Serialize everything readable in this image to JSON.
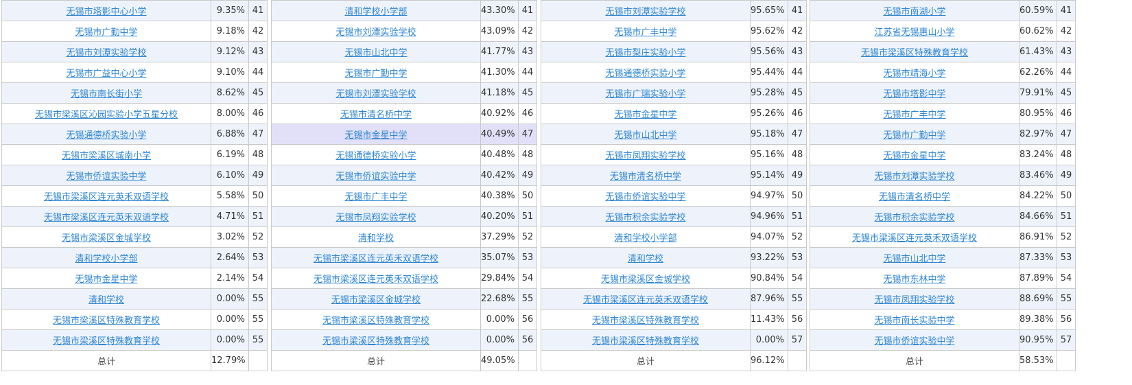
{
  "tables": [
    {
      "rows": [
        {
          "name": "无锡市塔影中心小学",
          "pct": "9.35%",
          "rank": "41"
        },
        {
          "name": "无锡市广勤中学",
          "pct": "9.18%",
          "rank": "42"
        },
        {
          "name": "无锡市刘潭实验学校",
          "pct": "9.12%",
          "rank": "43"
        },
        {
          "name": "无锡市广益中心小学",
          "pct": "9.10%",
          "rank": "44"
        },
        {
          "name": "无锡市南长街小学",
          "pct": "8.62%",
          "rank": "45"
        },
        {
          "name": "无锡市梁溪区沁园实验小学五星分校",
          "pct": "8.00%",
          "rank": "46"
        },
        {
          "name": "无锡通德桥实验小学",
          "pct": "6.88%",
          "rank": "47"
        },
        {
          "name": "无锡市梁溪区城南小学",
          "pct": "6.19%",
          "rank": "48"
        },
        {
          "name": "无锡市侨谊实验中学",
          "pct": "6.10%",
          "rank": "49"
        },
        {
          "name": "无锡市梁溪区连元英禾双语学校",
          "pct": "5.58%",
          "rank": "50"
        },
        {
          "name": "无锡市梁溪区连元英禾双语学校",
          "pct": "4.71%",
          "rank": "51"
        },
        {
          "name": "无锡市梁溪区金城学校",
          "pct": "3.02%",
          "rank": "52"
        },
        {
          "name": "清和学校小学部",
          "pct": "2.64%",
          "rank": "53"
        },
        {
          "name": "无锡市金星中学",
          "pct": "2.14%",
          "rank": "54"
        },
        {
          "name": "清和学校",
          "pct": "0.00%",
          "rank": "55"
        },
        {
          "name": "无锡市梁溪区特殊教育学校",
          "pct": "0.00%",
          "rank": "55"
        },
        {
          "name": "无锡市梁溪区特殊教育学校",
          "pct": "0.00%",
          "rank": "55"
        }
      ],
      "total": {
        "label": "总计",
        "pct": "12.79%"
      }
    },
    {
      "rows": [
        {
          "name": "清和学校小学部",
          "pct": "43.30%",
          "rank": "41"
        },
        {
          "name": "无锡市刘潭实验学校",
          "pct": "43.09%",
          "rank": "42"
        },
        {
          "name": "无锡市山北中学",
          "pct": "41.77%",
          "rank": "43"
        },
        {
          "name": "无锡市广勤中学",
          "pct": "41.30%",
          "rank": "44"
        },
        {
          "name": "无锡市刘潭实验学校",
          "pct": "41.18%",
          "rank": "45"
        },
        {
          "name": "无锡市清名桥中学",
          "pct": "40.92%",
          "rank": "46"
        },
        {
          "name": "无锡市金星中学",
          "pct": "40.49%",
          "rank": "47",
          "highlight": true
        },
        {
          "name": "无锡通德桥实验小学",
          "pct": "40.48%",
          "rank": "48"
        },
        {
          "name": "无锡市侨谊实验中学",
          "pct": "40.42%",
          "rank": "49"
        },
        {
          "name": "无锡市广丰中学",
          "pct": "40.38%",
          "rank": "50"
        },
        {
          "name": "无锡市凤翔实验学校",
          "pct": "40.20%",
          "rank": "51"
        },
        {
          "name": "清和学校",
          "pct": "37.29%",
          "rank": "52"
        },
        {
          "name": "无锡市梁溪区连元英禾双语学校",
          "pct": "35.07%",
          "rank": "53"
        },
        {
          "name": "无锡市梁溪区连元英禾双语学校",
          "pct": "29.84%",
          "rank": "54"
        },
        {
          "name": "无锡市梁溪区金城学校",
          "pct": "22.68%",
          "rank": "55"
        },
        {
          "name": "无锡市梁溪区特殊教育学校",
          "pct": "0.00%",
          "rank": "56"
        },
        {
          "name": "无锡市梁溪区特殊教育学校",
          "pct": "0.00%",
          "rank": "56"
        }
      ],
      "total": {
        "label": "总计",
        "pct": "49.05%"
      }
    },
    {
      "rows": [
        {
          "name": "无锡市刘潭实验学校",
          "pct": "95.65%",
          "rank": "41"
        },
        {
          "name": "无锡市广丰中学",
          "pct": "95.62%",
          "rank": "42"
        },
        {
          "name": "无锡市梨庄实验小学",
          "pct": "95.56%",
          "rank": "43"
        },
        {
          "name": "无锡通德桥实验小学",
          "pct": "95.44%",
          "rank": "44"
        },
        {
          "name": "无锡市广瑞实验小学",
          "pct": "95.28%",
          "rank": "45"
        },
        {
          "name": "无锡市金星中学",
          "pct": "95.26%",
          "rank": "46"
        },
        {
          "name": "无锡市山北中学",
          "pct": "95.18%",
          "rank": "47"
        },
        {
          "name": "无锡市凤翔实验学校",
          "pct": "95.16%",
          "rank": "48"
        },
        {
          "name": "无锡市清名桥中学",
          "pct": "95.14%",
          "rank": "49"
        },
        {
          "name": "无锡市侨谊实验中学",
          "pct": "94.97%",
          "rank": "50"
        },
        {
          "name": "无锡市积余实验学校",
          "pct": "94.96%",
          "rank": "51"
        },
        {
          "name": "清和学校小学部",
          "pct": "94.07%",
          "rank": "52"
        },
        {
          "name": "清和学校",
          "pct": "93.22%",
          "rank": "53"
        },
        {
          "name": "无锡市梁溪区金城学校",
          "pct": "90.84%",
          "rank": "54"
        },
        {
          "name": "无锡市梁溪区连元英禾双语学校",
          "pct": "87.96%",
          "rank": "55"
        },
        {
          "name": "无锡市梁溪区特殊教育学校",
          "pct": "11.43%",
          "rank": "56"
        },
        {
          "name": "无锡市梁溪区特殊教育学校",
          "pct": "0.00%",
          "rank": "57"
        }
      ],
      "total": {
        "label": "总计",
        "pct": "96.12%"
      }
    },
    {
      "rows": [
        {
          "name": "无锡市南湖小学",
          "pct": "60.59%",
          "rank": "41"
        },
        {
          "name": "江苏省无锡惠山小学",
          "pct": "60.62%",
          "rank": "42"
        },
        {
          "name": "无锡市梁溪区特殊教育学校",
          "pct": "61.43%",
          "rank": "43"
        },
        {
          "name": "无锡市靖海小学",
          "pct": "62.26%",
          "rank": "44"
        },
        {
          "name": "无锡市塔影中学",
          "pct": "79.91%",
          "rank": "45"
        },
        {
          "name": "无锡市广丰中学",
          "pct": "80.95%",
          "rank": "46"
        },
        {
          "name": "无锡市广勤中学",
          "pct": "82.97%",
          "rank": "47"
        },
        {
          "name": "无锡市金星中学",
          "pct": "83.24%",
          "rank": "48"
        },
        {
          "name": "无锡市刘潭实验学校",
          "pct": "83.46%",
          "rank": "49"
        },
        {
          "name": "无锡市清名桥中学",
          "pct": "84.22%",
          "rank": "50"
        },
        {
          "name": "无锡市积余实验学校",
          "pct": "84.66%",
          "rank": "51"
        },
        {
          "name": "无锡市梁溪区连元英禾双语学校",
          "pct": "86.91%",
          "rank": "52"
        },
        {
          "name": "无锡市山北中学",
          "pct": "87.33%",
          "rank": "53"
        },
        {
          "name": "无锡市东林中学",
          "pct": "87.89%",
          "rank": "54"
        },
        {
          "name": "无锡市凤翔实验学校",
          "pct": "88.69%",
          "rank": "55"
        },
        {
          "name": "无锡市南长实验中学",
          "pct": "89.38%",
          "rank": "56"
        },
        {
          "name": "无锡市侨谊实验中学",
          "pct": "90.95%",
          "rank": "57"
        }
      ],
      "total": {
        "label": "总计",
        "pct": "58.53%"
      }
    }
  ]
}
